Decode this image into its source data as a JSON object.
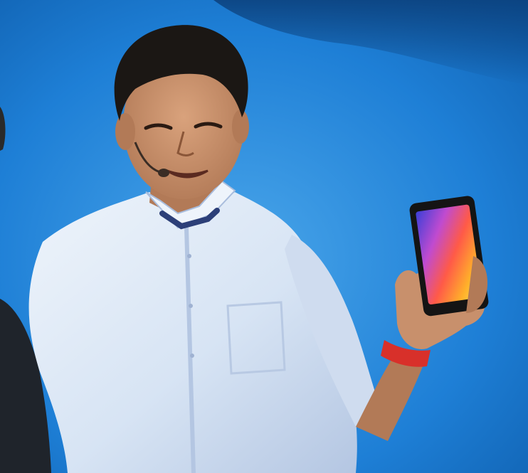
{
  "scene": {
    "colors": {
      "backdrop": "#1e7fd6",
      "backdrop_light": "#4aa6ea",
      "backdrop_dark": "#0f5fae",
      "shirt": "#dfe9f6",
      "shirt_shadow": "#b4c6e2",
      "collar_accent": "#2c3f78",
      "skin": "#c8906c",
      "skin_shadow": "#9c6748",
      "hair": "#1b1714",
      "phone_body": "#141414",
      "wristband": "#d8302a",
      "left_figure_jacket": "#1f242b"
    },
    "elements": [
      "presenter",
      "smartphone",
      "headset-microphone",
      "wristband",
      "left-edge-figure"
    ]
  }
}
